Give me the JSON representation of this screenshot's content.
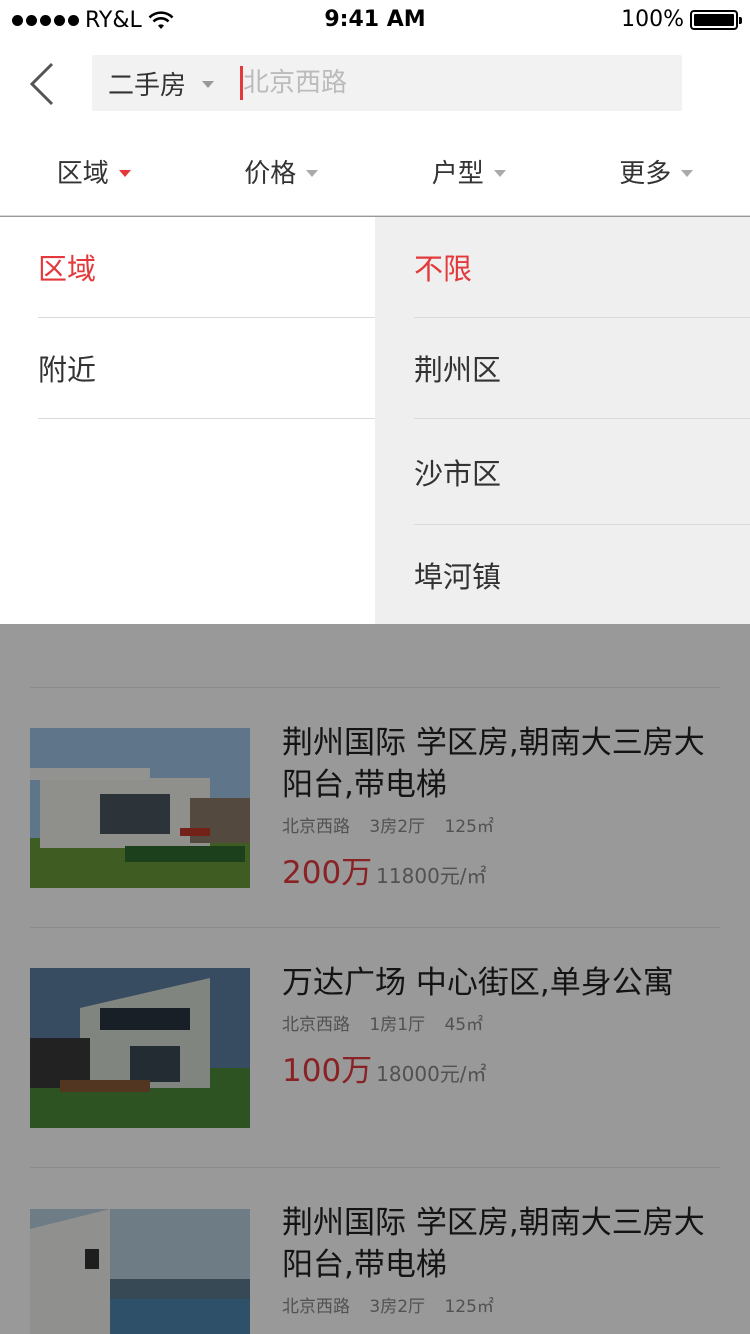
{
  "status_bar": {
    "carrier": "RY&L",
    "time": "9:41 AM",
    "battery": "100%"
  },
  "search": {
    "type_label": "二手房",
    "placeholder": "北京西路"
  },
  "filters": [
    {
      "label": "区域",
      "active": true
    },
    {
      "label": "价格",
      "active": false
    },
    {
      "label": "户型",
      "active": false
    },
    {
      "label": "更多",
      "active": false
    }
  ],
  "dropdown": {
    "left": [
      "区域",
      "附近"
    ],
    "right": [
      "不限",
      "荆州区",
      "沙市区",
      "埠河镇"
    ]
  },
  "listings": [
    {
      "title": "荆州国际 学区房,朝南大三房大阳台,带电梯",
      "area_name": "北京西路",
      "layout": "3房2厅",
      "size": "125㎡",
      "price": "200万",
      "unit_price": "11800元/㎡"
    },
    {
      "title": "万达广场 中心街区,单身公寓",
      "area_name": "北京西路",
      "layout": "1房1厅",
      "size": "45㎡",
      "price": "100万",
      "unit_price": "18000元/㎡"
    },
    {
      "title": "荆州国际 学区房,朝南大三房大阳台,带电梯",
      "area_name": "北京西路",
      "layout": "3房2厅",
      "size": "125㎡",
      "price": "",
      "unit_price": ""
    }
  ],
  "colors": {
    "accent": "#e4393c"
  }
}
